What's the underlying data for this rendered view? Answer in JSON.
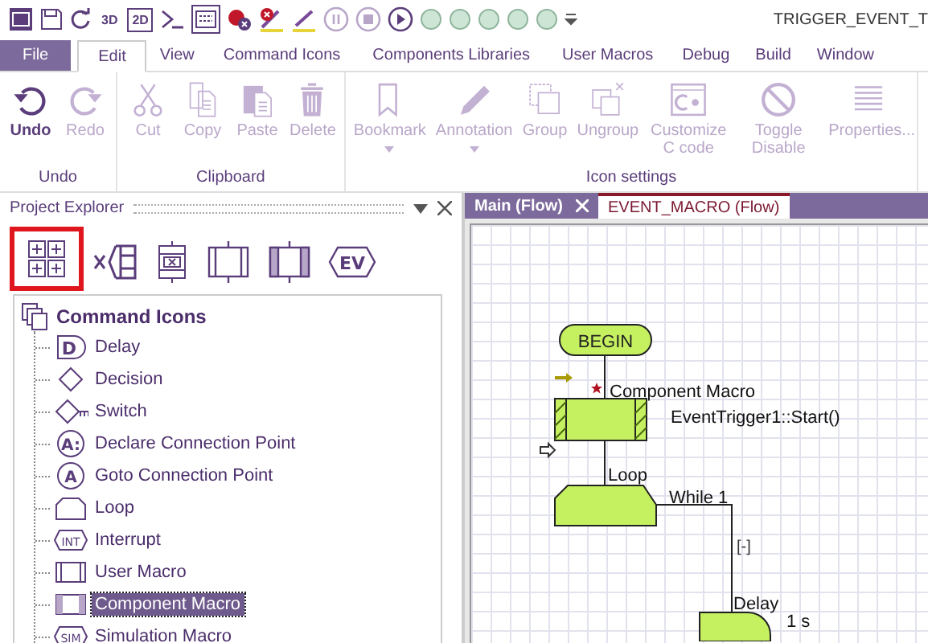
{
  "window": {
    "title": "TRIGGER_EVENT_T"
  },
  "quick_access": [
    {
      "kind": "app"
    },
    {
      "kind": "save"
    },
    {
      "kind": "redo"
    },
    {
      "kind": "view3d",
      "label": "3D"
    },
    {
      "kind": "view2d",
      "label": "2D"
    },
    {
      "kind": "console"
    },
    {
      "kind": "panel"
    },
    {
      "kind": "breakpoint-clear"
    },
    {
      "kind": "pen-clear"
    },
    {
      "kind": "pen"
    },
    {
      "kind": "pause"
    },
    {
      "kind": "stop"
    },
    {
      "kind": "play"
    },
    {
      "kind": "led"
    },
    {
      "kind": "led"
    },
    {
      "kind": "led"
    },
    {
      "kind": "led"
    },
    {
      "kind": "led"
    },
    {
      "kind": "more"
    }
  ],
  "file_menu": {
    "label": "File"
  },
  "menu_tabs": [
    {
      "label": "Edit",
      "selected": true
    },
    {
      "label": "View",
      "selected": false
    },
    {
      "label": "Command Icons",
      "selected": false
    },
    {
      "label": "Components Libraries",
      "selected": false
    },
    {
      "label": "User Macros",
      "selected": false
    },
    {
      "label": "Debug",
      "selected": false
    },
    {
      "label": "Build",
      "selected": false
    },
    {
      "label": "Window",
      "selected": false
    }
  ],
  "ribbon_groups": [
    {
      "label": "Undo",
      "buttons": [
        {
          "kind": "undo",
          "label": "Undo",
          "disabled": false
        },
        {
          "kind": "redo",
          "label": "Redo",
          "disabled": true
        }
      ]
    },
    {
      "label": "Clipboard",
      "buttons": [
        {
          "kind": "cut",
          "label": "Cut",
          "disabled": true
        },
        {
          "kind": "copy",
          "label": "Copy",
          "disabled": true
        },
        {
          "kind": "paste",
          "label": "Paste",
          "disabled": true
        },
        {
          "kind": "delete",
          "label": "Delete",
          "disabled": true
        }
      ]
    },
    {
      "label": "Icon settings",
      "buttons": [
        {
          "kind": "bookmark",
          "label": "Bookmark",
          "disabled": true,
          "dropdown": true
        },
        {
          "kind": "annotation",
          "label": "Annotation",
          "disabled": true,
          "dropdown": true
        },
        {
          "kind": "group",
          "label": "Group",
          "disabled": true
        },
        {
          "kind": "ungroup",
          "label": "Ungroup",
          "disabled": true
        },
        {
          "kind": "ccode",
          "label": "Customize C code",
          "disabled": true
        },
        {
          "kind": "toggle",
          "label": "Toggle Disable",
          "disabled": true
        },
        {
          "kind": "properties",
          "label": "Properties...",
          "disabled": true
        }
      ]
    }
  ],
  "project_explorer": {
    "title": "Project Explorer",
    "palette_tabs": [
      {
        "kind": "grid",
        "selected": true
      },
      {
        "kind": "variables",
        "selected": false
      },
      {
        "kind": "macro-x",
        "selected": false
      },
      {
        "kind": "macro",
        "selected": false
      },
      {
        "kind": "component",
        "selected": false
      },
      {
        "kind": "event",
        "label": "EV",
        "selected": false
      }
    ],
    "tree": {
      "label": "Command Icons",
      "children": [
        {
          "kind": "delay",
          "label": "Delay",
          "icon_text": "D",
          "selected": false
        },
        {
          "kind": "decision",
          "label": "Decision",
          "selected": false
        },
        {
          "kind": "switch",
          "label": "Switch",
          "selected": false
        },
        {
          "kind": "circle",
          "label": "Declare Connection Point",
          "icon_text": "A:",
          "selected": false
        },
        {
          "kind": "circle",
          "label": "Goto Connection Point",
          "icon_text": "A",
          "selected": false
        },
        {
          "kind": "loop",
          "label": "Loop",
          "selected": false
        },
        {
          "kind": "tag",
          "label": "Interrupt",
          "icon_text": "INT",
          "selected": false
        },
        {
          "kind": "macro",
          "label": "User Macro",
          "selected": false
        },
        {
          "kind": "component",
          "label": "Component Macro",
          "selected": true
        },
        {
          "kind": "tag",
          "label": "Simulation Macro",
          "icon_text": "SIM",
          "selected": false
        }
      ]
    }
  },
  "document_tabs": [
    {
      "label": "Main (Flow)",
      "selected": true,
      "closable": true
    },
    {
      "label": "EVENT_MACRO (Flow)",
      "selected": false,
      "closable": false
    }
  ],
  "flowchart": {
    "begin": "BEGIN",
    "component_macro": {
      "title": "Component Macro",
      "call": "EventTrigger1::Start()"
    },
    "loop": {
      "title": "Loop",
      "condition": "While 1",
      "collapse": "[-]"
    },
    "delay": {
      "title": "Delay",
      "value": "1 s"
    }
  }
}
